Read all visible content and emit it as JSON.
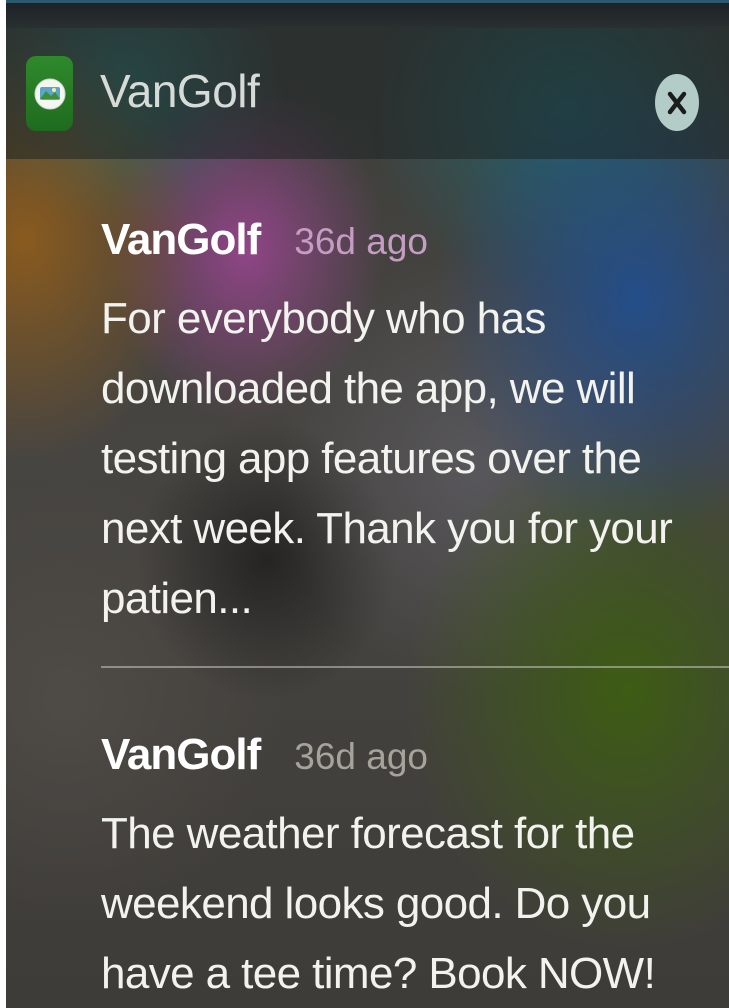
{
  "app": {
    "name": "VanGolf",
    "icon": "golf-app-icon"
  },
  "header": {
    "close_icon": "close-icon"
  },
  "notifications": [
    {
      "title": "VanGolf",
      "time": "36d ago",
      "body": "For everybody who has downloaded the app, we will testing app features over the next week.  Thank you for your patien..."
    },
    {
      "title": "VanGolf",
      "time": "36d ago",
      "body": "The weather forecast for the weekend looks good. Do you have a tee time? Book NOW!"
    }
  ],
  "colors": {
    "app_icon_green": "#2f8a2c",
    "close_button": "#b4ccc7",
    "timestamp_first": "#c69cc4",
    "timestamp_second": "#a6a39a"
  }
}
